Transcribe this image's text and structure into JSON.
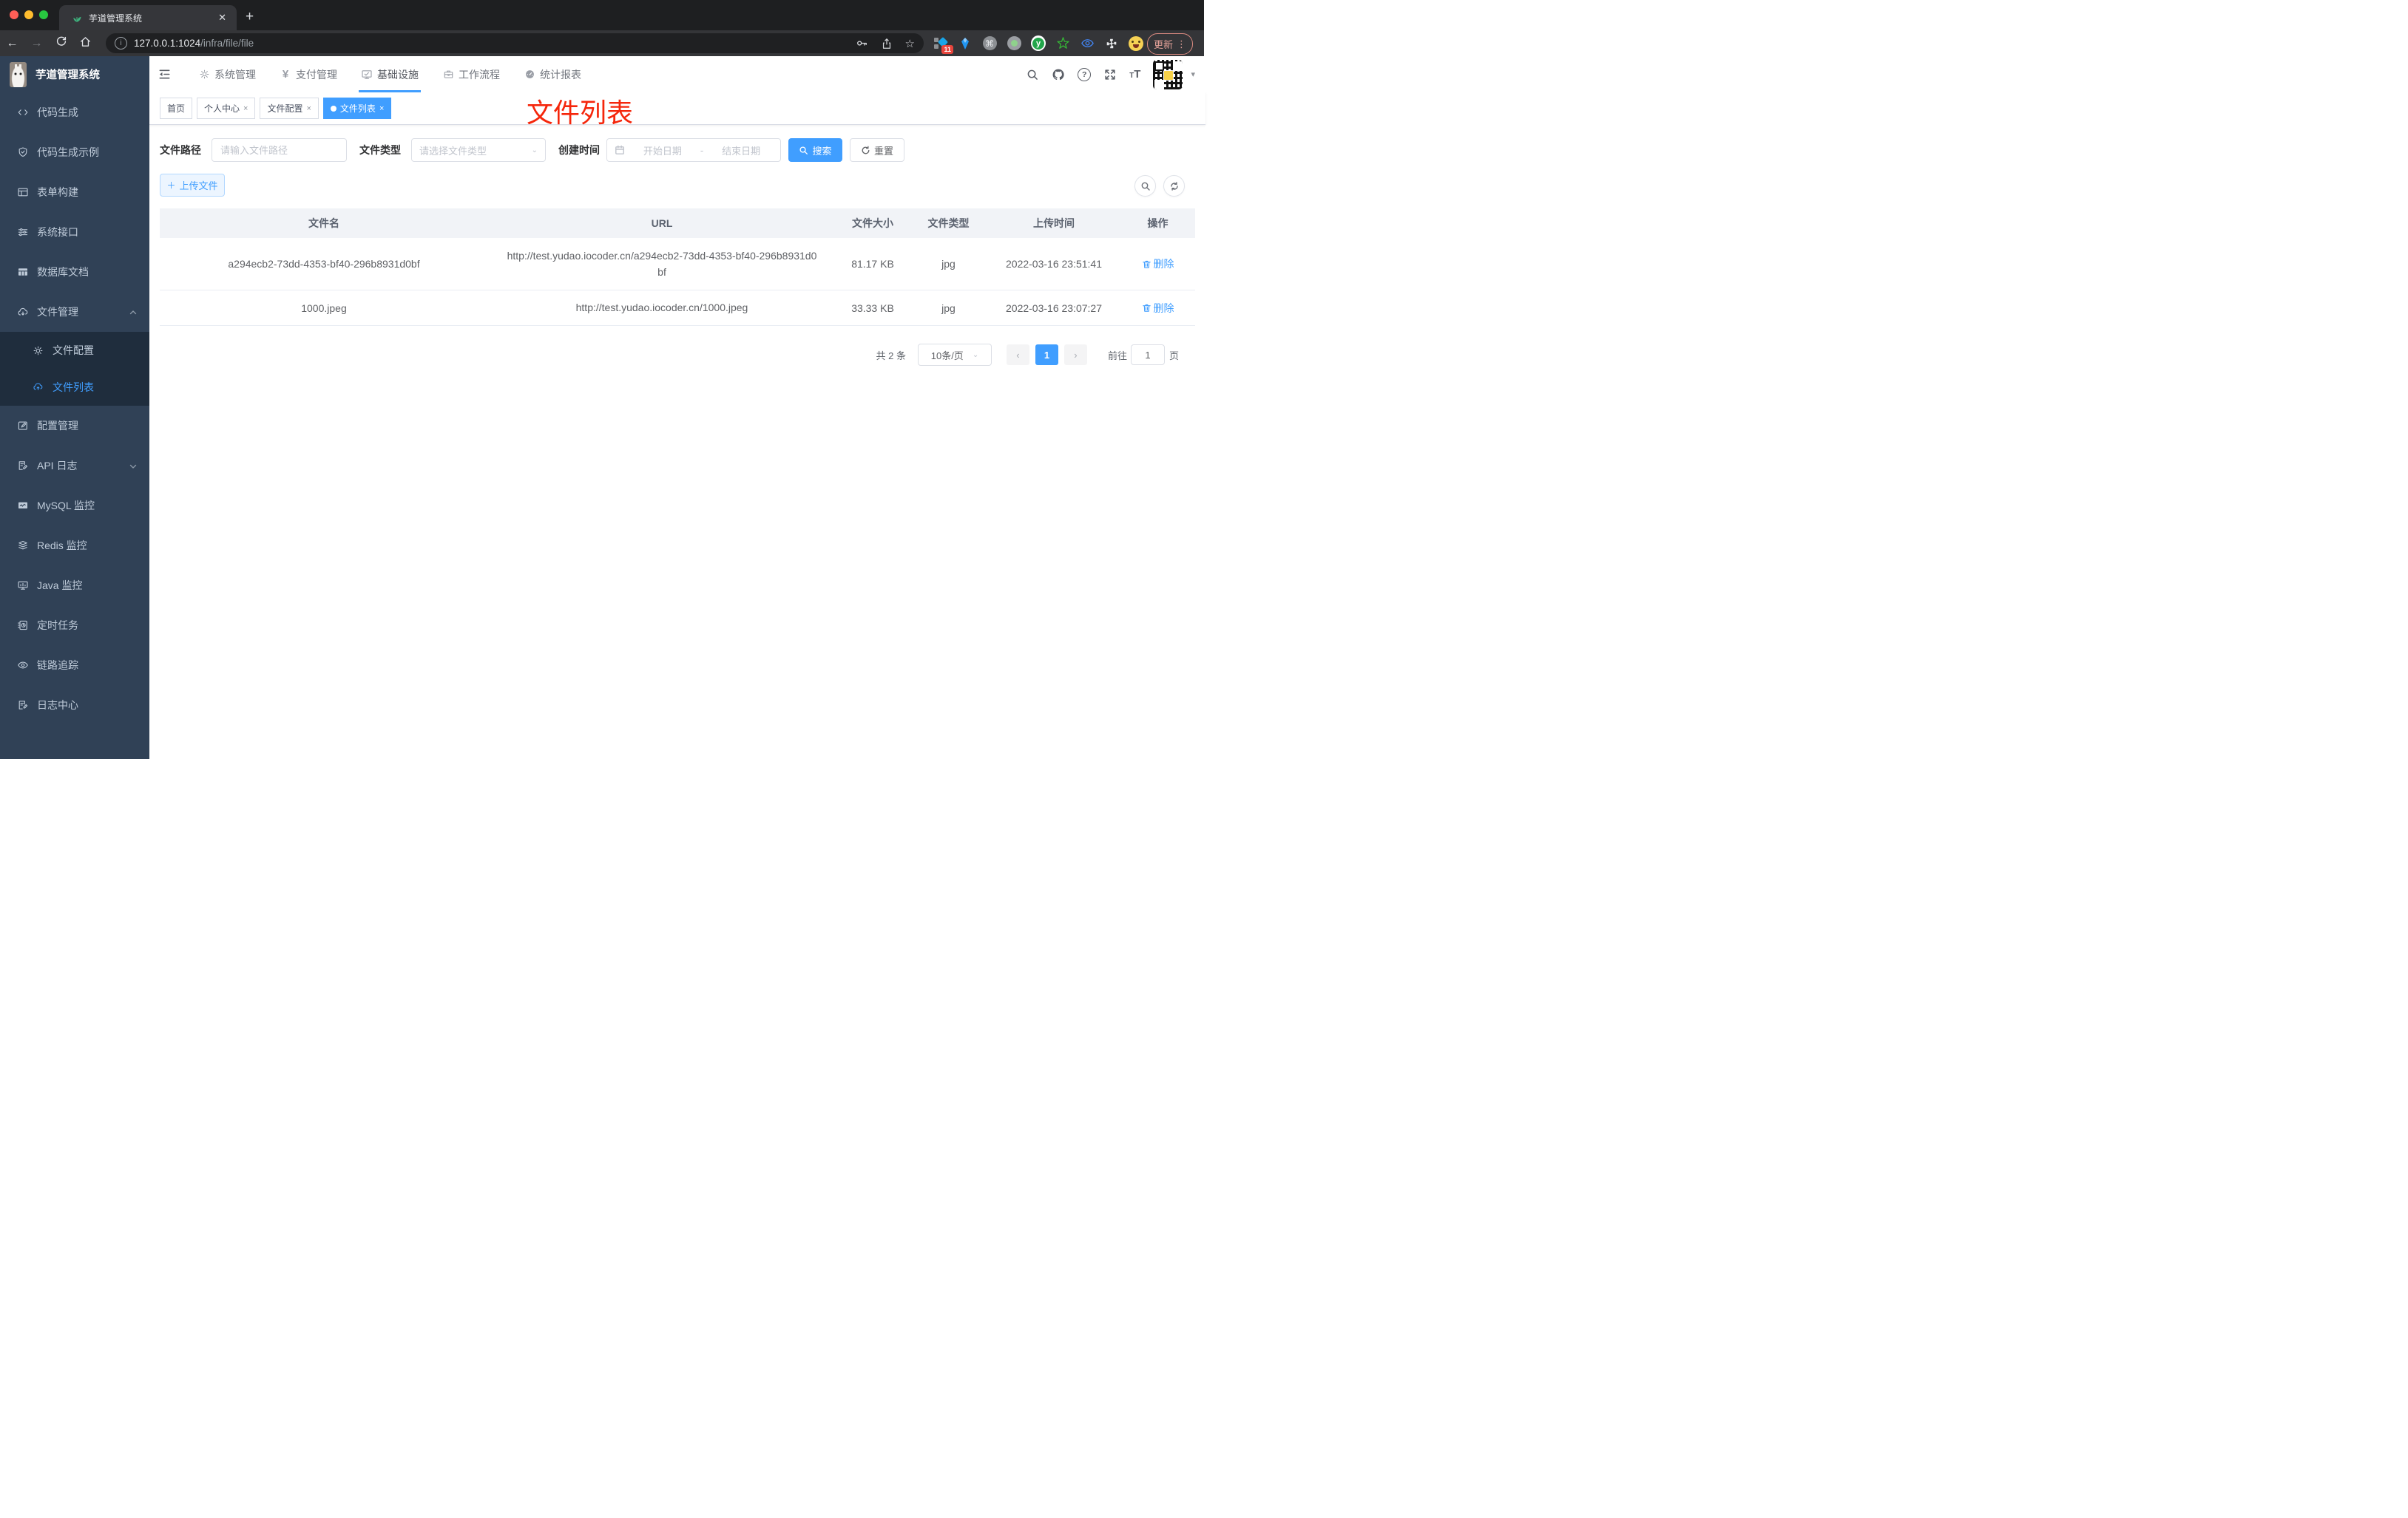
{
  "browser": {
    "tab_title": "芋道管理系统",
    "new_tab_glyph": "+",
    "close_glyph": "✕",
    "url_host": "127.0.0.1:1024",
    "url_path": "/infra/file/file",
    "extension_badge": "11",
    "cmd_glyph": "⌘",
    "y_glyph": "y",
    "star_glyph": "☆",
    "back_glyph": "←",
    "forward_glyph": "→",
    "info_glyph": "i",
    "update_button": "更新",
    "menu_dots": "⋮"
  },
  "annotation": {
    "text": "文件列表",
    "color": "#f5260b"
  },
  "app": {
    "title": "芋道管理系统",
    "top_nav": [
      {
        "label": "系统管理"
      },
      {
        "label": "支付管理"
      },
      {
        "label": "基础设施"
      },
      {
        "label": "工作流程"
      },
      {
        "label": "统计报表"
      }
    ],
    "active_nav": "基础设施",
    "nav_pay_glyph": "¥",
    "gear_glyph": "⚙",
    "help_glyph": "?",
    "caret_glyph": "▾",
    "tsize_large": "T",
    "tsize_small": "T"
  },
  "tags": [
    {
      "label": "首页",
      "closable": false,
      "active": false
    },
    {
      "label": "个人中心",
      "closable": true,
      "active": false
    },
    {
      "label": "文件配置",
      "closable": true,
      "active": false
    },
    {
      "label": "文件列表",
      "closable": true,
      "active": true
    }
  ],
  "tag_close_glyph": "×",
  "sidebar": {
    "items": [
      {
        "label": "代码生成"
      },
      {
        "label": "代码生成示例"
      },
      {
        "label": "表单构建"
      },
      {
        "label": "系统接口"
      },
      {
        "label": "数据库文档"
      },
      {
        "label": "文件管理",
        "expanded": true,
        "children": [
          {
            "label": "文件配置"
          },
          {
            "label": "文件列表",
            "active": true
          }
        ]
      },
      {
        "label": "配置管理"
      },
      {
        "label": "API 日志",
        "expanded": false
      },
      {
        "label": "MySQL 监控"
      },
      {
        "label": "Redis 监控"
      },
      {
        "label": "Java 监控"
      },
      {
        "label": "定时任务"
      },
      {
        "label": "链路追踪"
      },
      {
        "label": "日志中心"
      }
    ]
  },
  "filters": {
    "path_label": "文件路径",
    "path_placeholder": "请输入文件路径",
    "type_label": "文件类型",
    "type_placeholder": "请选择文件类型",
    "time_label": "创建时间",
    "start_placeholder": "开始日期",
    "range_separator": "-",
    "end_placeholder": "结束日期",
    "search_label": "搜索",
    "reset_label": "重置"
  },
  "toolbar": {
    "upload_label": "上传文件",
    "plus_glyph": "＋"
  },
  "table": {
    "headers": [
      "文件名",
      "URL",
      "文件大小",
      "文件类型",
      "上传时间",
      "操作"
    ],
    "rows": [
      {
        "name": "a294ecb2-73dd-4353-bf40-296b8931d0bf",
        "url": "http://test.yudao.iocoder.cn/a294ecb2-73dd-4353-bf40-296b8931d0bf",
        "size": "81.17 KB",
        "type": "jpg",
        "time": "2022-03-16 23:51:41",
        "action": "删除"
      },
      {
        "name": "1000.jpeg",
        "url": "http://test.yudao.iocoder.cn/1000.jpeg",
        "size": "33.33 KB",
        "type": "jpg",
        "time": "2022-03-16 23:07:27",
        "action": "删除"
      }
    ]
  },
  "pagination": {
    "total_text": "共 2 条",
    "page_size": "10条/页",
    "prev_glyph": "‹",
    "current_page": "1",
    "next_glyph": "›",
    "goto_label": "前往",
    "goto_value": "1",
    "goto_suffix": "页"
  },
  "colors": {
    "accent": "#409eff",
    "sidebar_bg": "#304156",
    "submenu_bg": "#1f2d3d",
    "annotation_red": "#f5260b"
  }
}
